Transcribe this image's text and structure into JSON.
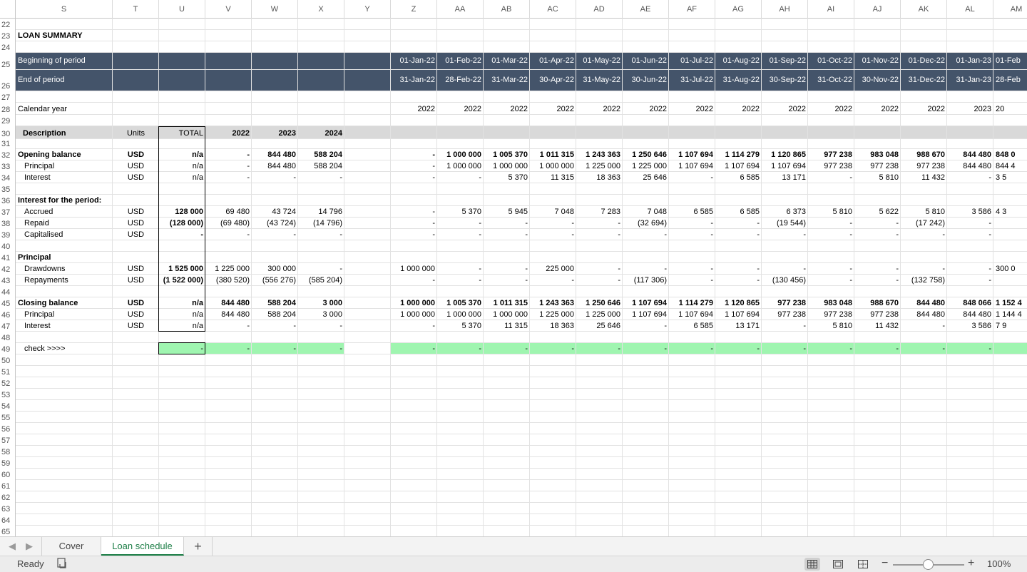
{
  "columns": [
    "S",
    "T",
    "U",
    "V",
    "W",
    "X",
    "Y",
    "Z",
    "AA",
    "AB",
    "AC",
    "AD",
    "AE",
    "AF",
    "AG",
    "AH",
    "AI",
    "AJ",
    "AK",
    "AL",
    "AM"
  ],
  "rows": [
    "22",
    "23",
    "24",
    "25",
    "26",
    "27",
    "28",
    "29",
    "30",
    "31",
    "32",
    "33",
    "34",
    "35",
    "36",
    "37",
    "38",
    "39",
    "40",
    "41",
    "42",
    "43",
    "44",
    "45",
    "46",
    "47",
    "48",
    "49",
    "50",
    "51",
    "52",
    "53",
    "54",
    "55",
    "56",
    "57",
    "58",
    "59",
    "60",
    "61",
    "62",
    "63",
    "64",
    "65"
  ],
  "title": "LOAN SUMMARY",
  "period_header": {
    "begin_label": "Beginning of period",
    "end_label": "End of period",
    "begin_dates": [
      "01-Jan-22",
      "01-Feb-22",
      "01-Mar-22",
      "01-Apr-22",
      "01-May-22",
      "01-Jun-22",
      "01-Jul-22",
      "01-Aug-22",
      "01-Sep-22",
      "01-Oct-22",
      "01-Nov-22",
      "01-Dec-22",
      "01-Jan-23",
      "01-Feb"
    ],
    "end_dates": [
      "31-Jan-22",
      "28-Feb-22",
      "31-Mar-22",
      "30-Apr-22",
      "31-May-22",
      "30-Jun-22",
      "31-Jul-22",
      "31-Aug-22",
      "30-Sep-22",
      "31-Oct-22",
      "30-Nov-22",
      "31-Dec-22",
      "31-Jan-23",
      "28-Feb"
    ]
  },
  "calendar_year": {
    "label": "Calendar year",
    "values": [
      "2022",
      "2022",
      "2022",
      "2022",
      "2022",
      "2022",
      "2022",
      "2022",
      "2022",
      "2022",
      "2022",
      "2022",
      "2023",
      "20"
    ]
  },
  "table_header": {
    "description": "Description",
    "units": "Units",
    "total": "TOTAL",
    "y1": "2022",
    "y2": "2023",
    "y3": "2024"
  },
  "body": [
    {
      "row": "32",
      "label": "Opening balance",
      "indent": false,
      "bold": true,
      "units": "USD",
      "total": "n/a",
      "years": [
        "-",
        "844 480",
        "588 204"
      ],
      "months": [
        "-",
        "1 000 000",
        "1 005 370",
        "1 011 315",
        "1 243 363",
        "1 250 646",
        "1 107 694",
        "1 114 279",
        "1 120 865",
        "977 238",
        "983 048",
        "988 670",
        "844 480",
        "848 0"
      ]
    },
    {
      "row": "33",
      "label": "Principal",
      "indent": true,
      "bold": false,
      "units": "USD",
      "total": "n/a",
      "years": [
        "-",
        "844 480",
        "588 204"
      ],
      "months": [
        "-",
        "1 000 000",
        "1 000 000",
        "1 000 000",
        "1 225 000",
        "1 225 000",
        "1 107 694",
        "1 107 694",
        "1 107 694",
        "977 238",
        "977 238",
        "977 238",
        "844 480",
        "844 4"
      ]
    },
    {
      "row": "34",
      "label": "Interest",
      "indent": true,
      "bold": false,
      "units": "USD",
      "total": "n/a",
      "years": [
        "-",
        "-",
        "-"
      ],
      "months": [
        "-",
        "-",
        "5 370",
        "11 315",
        "18 363",
        "25 646",
        "-",
        "6 585",
        "13 171",
        "-",
        "5 810",
        "11 432",
        "-",
        "3 5"
      ]
    },
    {
      "row": "36",
      "label": "Interest for the period:",
      "indent": false,
      "bold": true,
      "units": "",
      "total": "",
      "years": [
        "",
        "",
        ""
      ],
      "months": []
    },
    {
      "row": "37",
      "label": "Accrued",
      "indent": true,
      "bold": false,
      "units": "USD",
      "total": "128 000",
      "total_bold": true,
      "years": [
        "69 480",
        "43 724",
        "14 796"
      ],
      "months": [
        "-",
        "5 370",
        "5 945",
        "7 048",
        "7 283",
        "7 048",
        "6 585",
        "6 585",
        "6 373",
        "5 810",
        "5 622",
        "5 810",
        "3 586",
        "4 3"
      ]
    },
    {
      "row": "38",
      "label": "Repaid",
      "indent": true,
      "bold": false,
      "units": "USD",
      "total": "(128 000)",
      "total_bold": true,
      "years": [
        "(69 480)",
        "(43 724)",
        "(14 796)"
      ],
      "months": [
        "-",
        "-",
        "-",
        "-",
        "-",
        "(32 694)",
        "-",
        "-",
        "(19 544)",
        "-",
        "-",
        "(17 242)",
        "-",
        ""
      ]
    },
    {
      "row": "39",
      "label": "Capitalised",
      "indent": true,
      "bold": false,
      "units": "USD",
      "total": "-",
      "total_bold": true,
      "years": [
        "-",
        "-",
        "-"
      ],
      "months": [
        "-",
        "-",
        "-",
        "-",
        "-",
        "-",
        "-",
        "-",
        "-",
        "-",
        "-",
        "-",
        "-",
        ""
      ]
    },
    {
      "row": "41",
      "label": "Principal",
      "indent": false,
      "bold": true,
      "units": "",
      "total": "",
      "years": [
        "",
        "",
        ""
      ],
      "months": []
    },
    {
      "row": "42",
      "label": "Drawdowns",
      "indent": true,
      "bold": false,
      "units": "USD",
      "total": "1 525 000",
      "total_bold": true,
      "years": [
        "1 225 000",
        "300 000",
        "-"
      ],
      "months": [
        "1 000 000",
        "-",
        "-",
        "225 000",
        "-",
        "-",
        "-",
        "-",
        "-",
        "-",
        "-",
        "-",
        "-",
        "300 0"
      ]
    },
    {
      "row": "43",
      "label": "Repayments",
      "indent": true,
      "bold": false,
      "units": "USD",
      "total": "(1 522 000)",
      "total_bold": true,
      "years": [
        "(380 520)",
        "(556 276)",
        "(585 204)"
      ],
      "months": [
        "-",
        "-",
        "-",
        "-",
        "-",
        "(117 306)",
        "-",
        "-",
        "(130 456)",
        "-",
        "-",
        "(132 758)",
        "-",
        ""
      ]
    },
    {
      "row": "45",
      "label": "Closing balance",
      "indent": false,
      "bold": true,
      "units": "USD",
      "total": "n/a",
      "years": [
        "844 480",
        "588 204",
        "3 000"
      ],
      "months": [
        "1 000 000",
        "1 005 370",
        "1 011 315",
        "1 243 363",
        "1 250 646",
        "1 107 694",
        "1 114 279",
        "1 120 865",
        "977 238",
        "983 048",
        "988 670",
        "844 480",
        "848 066",
        "1 152 4"
      ]
    },
    {
      "row": "46",
      "label": "Principal",
      "indent": true,
      "bold": false,
      "units": "USD",
      "total": "n/a",
      "years": [
        "844 480",
        "588 204",
        "3 000"
      ],
      "months": [
        "1 000 000",
        "1 000 000",
        "1 000 000",
        "1 225 000",
        "1 225 000",
        "1 107 694",
        "1 107 694",
        "1 107 694",
        "977 238",
        "977 238",
        "977 238",
        "844 480",
        "844 480",
        "1 144 4"
      ]
    },
    {
      "row": "47",
      "label": "Interest",
      "indent": true,
      "bold": false,
      "units": "USD",
      "total": "n/a",
      "years": [
        "-",
        "-",
        "-"
      ],
      "months": [
        "-",
        "5 370",
        "11 315",
        "18 363",
        "25 646",
        "-",
        "6 585",
        "13 171",
        "-",
        "5 810",
        "11 432",
        "-",
        "3 586",
        "7 9"
      ]
    }
  ],
  "check": {
    "label": "check >>>>",
    "total": "-",
    "years": [
      "-",
      "-",
      "-"
    ],
    "months": [
      "-",
      "-",
      "-",
      "-",
      "-",
      "-",
      "-",
      "-",
      "-",
      "-",
      "-",
      "-",
      "-",
      ""
    ]
  },
  "tabs": {
    "cover": "Cover",
    "loan_schedule": "Loan schedule",
    "add": "+"
  },
  "status": {
    "ready": "Ready",
    "zoom": "100%",
    "minus": "−",
    "plus": "+"
  },
  "colors": {
    "header_band": "#44546a",
    "desc_band": "#d9d9d9",
    "check_fill": "#9ff5b0",
    "accent": "#1b7d45"
  }
}
